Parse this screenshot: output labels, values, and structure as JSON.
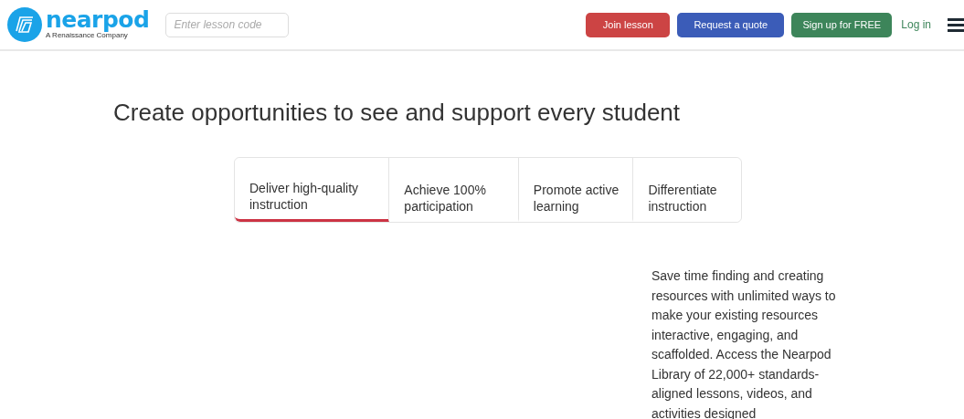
{
  "header": {
    "logo": {
      "wordmark": "nearpod",
      "tagline": "A Renaissance Company"
    },
    "lesson_code": {
      "placeholder": "Enter lesson code"
    },
    "buttons": [
      {
        "label": "Join lesson",
        "kind": "join"
      },
      {
        "label": "Request a quote",
        "kind": "quote"
      },
      {
        "label": "Sign up for FREE",
        "kind": "signup"
      }
    ],
    "login": "Log in"
  },
  "heading": "Create opportunities to see and support every student",
  "tabs": [
    {
      "label": "Deliver high-quality instruction",
      "selected": true
    },
    {
      "label": "Achieve 100% participation",
      "selected": false
    },
    {
      "label": "Promote active learning",
      "selected": false
    },
    {
      "label": "Differentiate instruction",
      "selected": false
    }
  ],
  "description": "Save time finding and creating resources with unlimited ways to make your existing resources interactive, engaging, and scaffolded. Access the Nearpod Library of 22,000+ standards-aligned lessons, videos, and activities designed"
}
